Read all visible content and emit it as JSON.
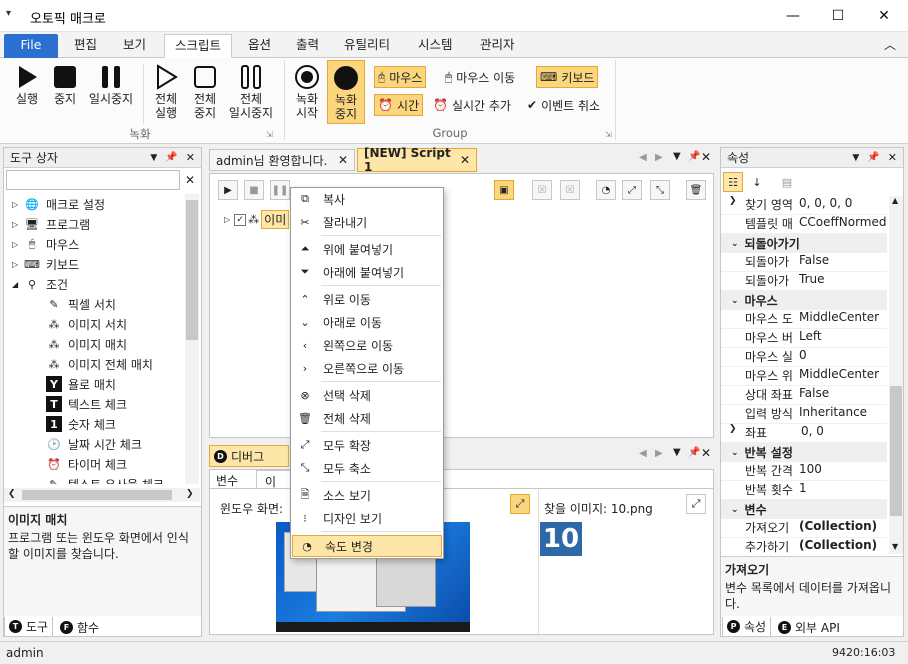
{
  "window": {
    "title": "오토픽 매크로",
    "minimize": "—",
    "maximize": "☐",
    "close": "✕",
    "sysmenu": "▾"
  },
  "menu": {
    "file": "File",
    "tabs": [
      "편집",
      "보기",
      "스크립트",
      "옵션",
      "출력",
      "유틸리티",
      "시스템",
      "관리자"
    ],
    "active": "스크립트",
    "collapse": "︿"
  },
  "ribbon": {
    "run": "실행",
    "stop": "중지",
    "pause": "일시중지",
    "all_run": [
      "전체",
      "실행"
    ],
    "all_stop": [
      "전체",
      "중지"
    ],
    "all_pause": [
      "전체",
      "일시중지"
    ],
    "rec_start": [
      "녹화",
      "시작"
    ],
    "rec_stop": [
      "녹화",
      "중지"
    ],
    "mouse": "마우스",
    "mouse_move": "마우스 이동",
    "keyboard": "키보드",
    "time": "시간",
    "realtime_add": "실시간 추가",
    "event_cancel": "이벤트 취소",
    "group_record": "녹화",
    "group_group": "Group"
  },
  "toolbox": {
    "title": "도구 상자",
    "items": [
      {
        "label": "매크로 설정",
        "icon": "globe-icon"
      },
      {
        "label": "프로그램",
        "icon": "monitor-icon"
      },
      {
        "label": "마우스",
        "icon": "mouse-icon"
      },
      {
        "label": "키보드",
        "icon": "keyboard-icon"
      },
      {
        "label": "조건",
        "icon": "condition-icon"
      },
      {
        "label": "픽셀 서치",
        "icon": "eyedropper-icon"
      },
      {
        "label": "이미지 서치",
        "icon": "image-search-icon"
      },
      {
        "label": "이미지 매치",
        "icon": "image-match-icon"
      },
      {
        "label": "이미지 전체 매치",
        "icon": "image-all-match-icon"
      },
      {
        "label": "욜로 매치",
        "icon": "yolo-icon"
      },
      {
        "label": "텍스트 체크",
        "icon": "text-check-icon"
      },
      {
        "label": "숫자 체크",
        "icon": "number-check-icon"
      },
      {
        "label": "날짜 시간 체크",
        "icon": "clock-icon"
      },
      {
        "label": "타이머 체크",
        "icon": "alarm-icon"
      },
      {
        "label": "텍스트 유사율 체크",
        "icon": "text-similar-icon"
      }
    ],
    "desc_title": "이미지 매치",
    "desc_text": "프로그램 또는 윈도우 화면에서 인식할 이미지를 찾습니다.",
    "tab_tools": "도구",
    "tab_funcs": "함수"
  },
  "doc_tabs": [
    {
      "label": "admin님 환영합니다."
    },
    {
      "label": "[NEW] Script 1"
    }
  ],
  "script_item": "이미",
  "context_menu": [
    {
      "label": "복사",
      "icon": "copy-icon"
    },
    {
      "label": "잘라내기",
      "icon": "scissors-icon"
    },
    {
      "label": "위에 붙여넣기",
      "icon": "paste-above-icon"
    },
    {
      "label": "아래에 붙여넣기",
      "icon": "paste-below-icon"
    },
    {
      "label": "위로 이동",
      "icon": "arrow-up-icon"
    },
    {
      "label": "아래로 이동",
      "icon": "arrow-down-icon"
    },
    {
      "label": "왼쪽으로 이동",
      "icon": "arrow-left-icon"
    },
    {
      "label": "오른쪽으로 이동",
      "icon": "arrow-right-icon"
    },
    {
      "label": "선택 삭제",
      "icon": "delete-icon"
    },
    {
      "label": "전체 삭제",
      "icon": "trash-icon"
    },
    {
      "label": "모두 확장",
      "icon": "expand-icon"
    },
    {
      "label": "모두 축소",
      "icon": "collapse-icon"
    },
    {
      "label": "소스 보기",
      "icon": "source-icon"
    },
    {
      "label": "디자인 보기",
      "icon": "design-icon"
    },
    {
      "label": "속도 변경",
      "icon": "speed-icon"
    }
  ],
  "debug": {
    "tab": "디버그",
    "subtabs": [
      "변수",
      "이"
    ],
    "window_label": "윈도우 화면: ",
    "found_label": "찾을 이미지: 10.png",
    "found_number": "10"
  },
  "props": {
    "title": "속성",
    "rows": [
      {
        "type": "row",
        "k": "찾기 영역",
        "v": "0, 0, 0, 0",
        "exp": true
      },
      {
        "type": "row",
        "k": "템플릿 매",
        "v": "CCoeffNormed"
      },
      {
        "type": "cat",
        "k": "되돌아가기"
      },
      {
        "type": "row",
        "k": "되돌아가",
        "v": "False"
      },
      {
        "type": "row",
        "k": "되돌아가",
        "v": "True"
      },
      {
        "type": "cat",
        "k": "마우스"
      },
      {
        "type": "row",
        "k": "마우스 도",
        "v": "MiddleCenter"
      },
      {
        "type": "row",
        "k": "마우스 버",
        "v": "Left"
      },
      {
        "type": "row",
        "k": "마우스 실",
        "v": "0"
      },
      {
        "type": "row",
        "k": "마우스 위",
        "v": "MiddleCenter"
      },
      {
        "type": "row",
        "k": "상대 좌표",
        "v": "False"
      },
      {
        "type": "row",
        "k": "입력 방식",
        "v": "Inheritance"
      },
      {
        "type": "row",
        "k": "좌표",
        "v": "0, 0",
        "exp": true
      },
      {
        "type": "cat",
        "k": "반복 설정"
      },
      {
        "type": "row",
        "k": "반복 간격",
        "v": "100"
      },
      {
        "type": "row",
        "k": "반복 횟수",
        "v": "1"
      },
      {
        "type": "cat",
        "k": "변수"
      },
      {
        "type": "row",
        "k": "가져오기",
        "v": "(Collection)",
        "bold": true
      },
      {
        "type": "row",
        "k": "추가하기",
        "v": "(Collection)",
        "bold": true
      }
    ],
    "desc_title": "가져오기",
    "desc_text": "변수 목록에서 데이터를 가져옵니다.",
    "tab_props": "속성",
    "tab_api": "외부 API"
  },
  "status": {
    "user": "admin",
    "time": "9420:16:03"
  },
  "colors": {
    "accent": "#2b6fd0",
    "highlight": "#fcd67d",
    "selection": "#fde6a8"
  }
}
